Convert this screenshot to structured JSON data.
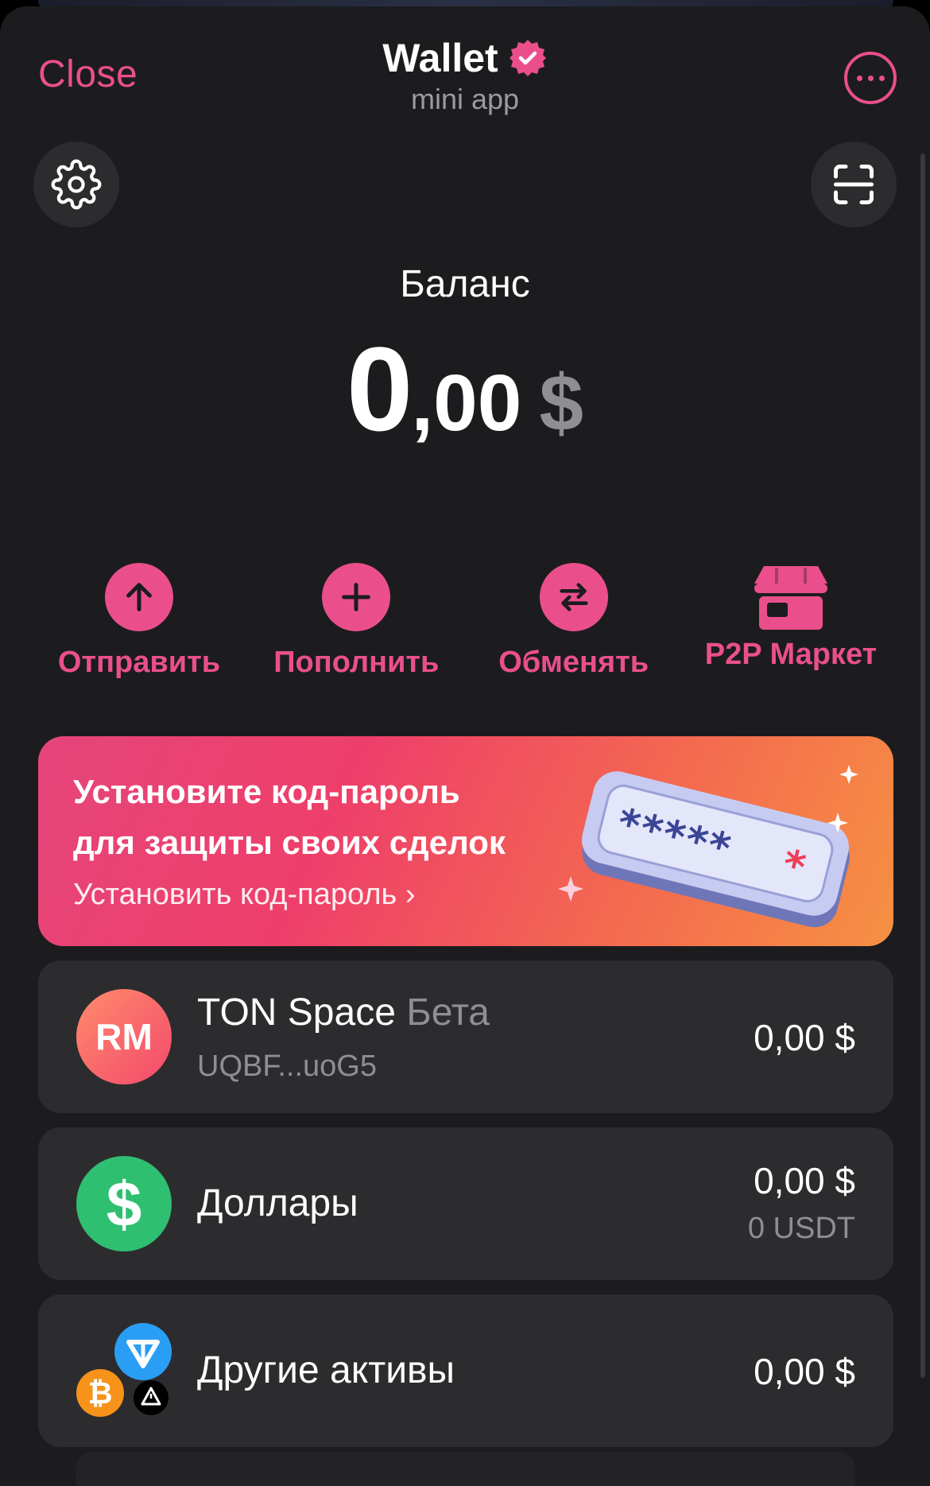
{
  "header": {
    "close_label": "Close",
    "title": "Wallet",
    "subtitle": "mini app",
    "verified_icon": "verified-badge-icon",
    "more_icon": "more-horizontal-icon"
  },
  "toolbar": {
    "settings_icon": "gear-icon",
    "scan_icon": "scan-qr-icon"
  },
  "balance": {
    "label": "Баланс",
    "integer": "0",
    "decimal": ",00",
    "currency": "$"
  },
  "actions": [
    {
      "label": "Отправить",
      "icon": "arrow-up-icon"
    },
    {
      "label": "Пополнить",
      "icon": "plus-icon"
    },
    {
      "label": "Обменять",
      "icon": "swap-icon"
    },
    {
      "label": "P2P Маркет",
      "icon": "store-icon"
    }
  ],
  "banner": {
    "title_line1": "Установите код-пароль",
    "title_line2": "для защиты своих сделок",
    "link_label": "Установить код-пароль ›",
    "art_icon": "passcode-field-illustration"
  },
  "assets": [
    {
      "avatar": "RM",
      "name": "TON Space",
      "tag": "Бета",
      "address": "UQBF...uoG5",
      "amount": "0,00 $"
    },
    {
      "avatar_icon": "dollar-icon",
      "name": "Доллары",
      "amount": "0,00 $",
      "amount_sub": "0 USDT"
    },
    {
      "avatar_icon": "crypto-stack-icon",
      "name": "Другие активы",
      "amount": "0,00 $"
    }
  ],
  "colors": {
    "accent": "#ea4f8c",
    "background": "#1c1c1e",
    "card": "#2c2c2e",
    "muted": "#8e8e93",
    "usdt_green": "#2fbf71"
  }
}
